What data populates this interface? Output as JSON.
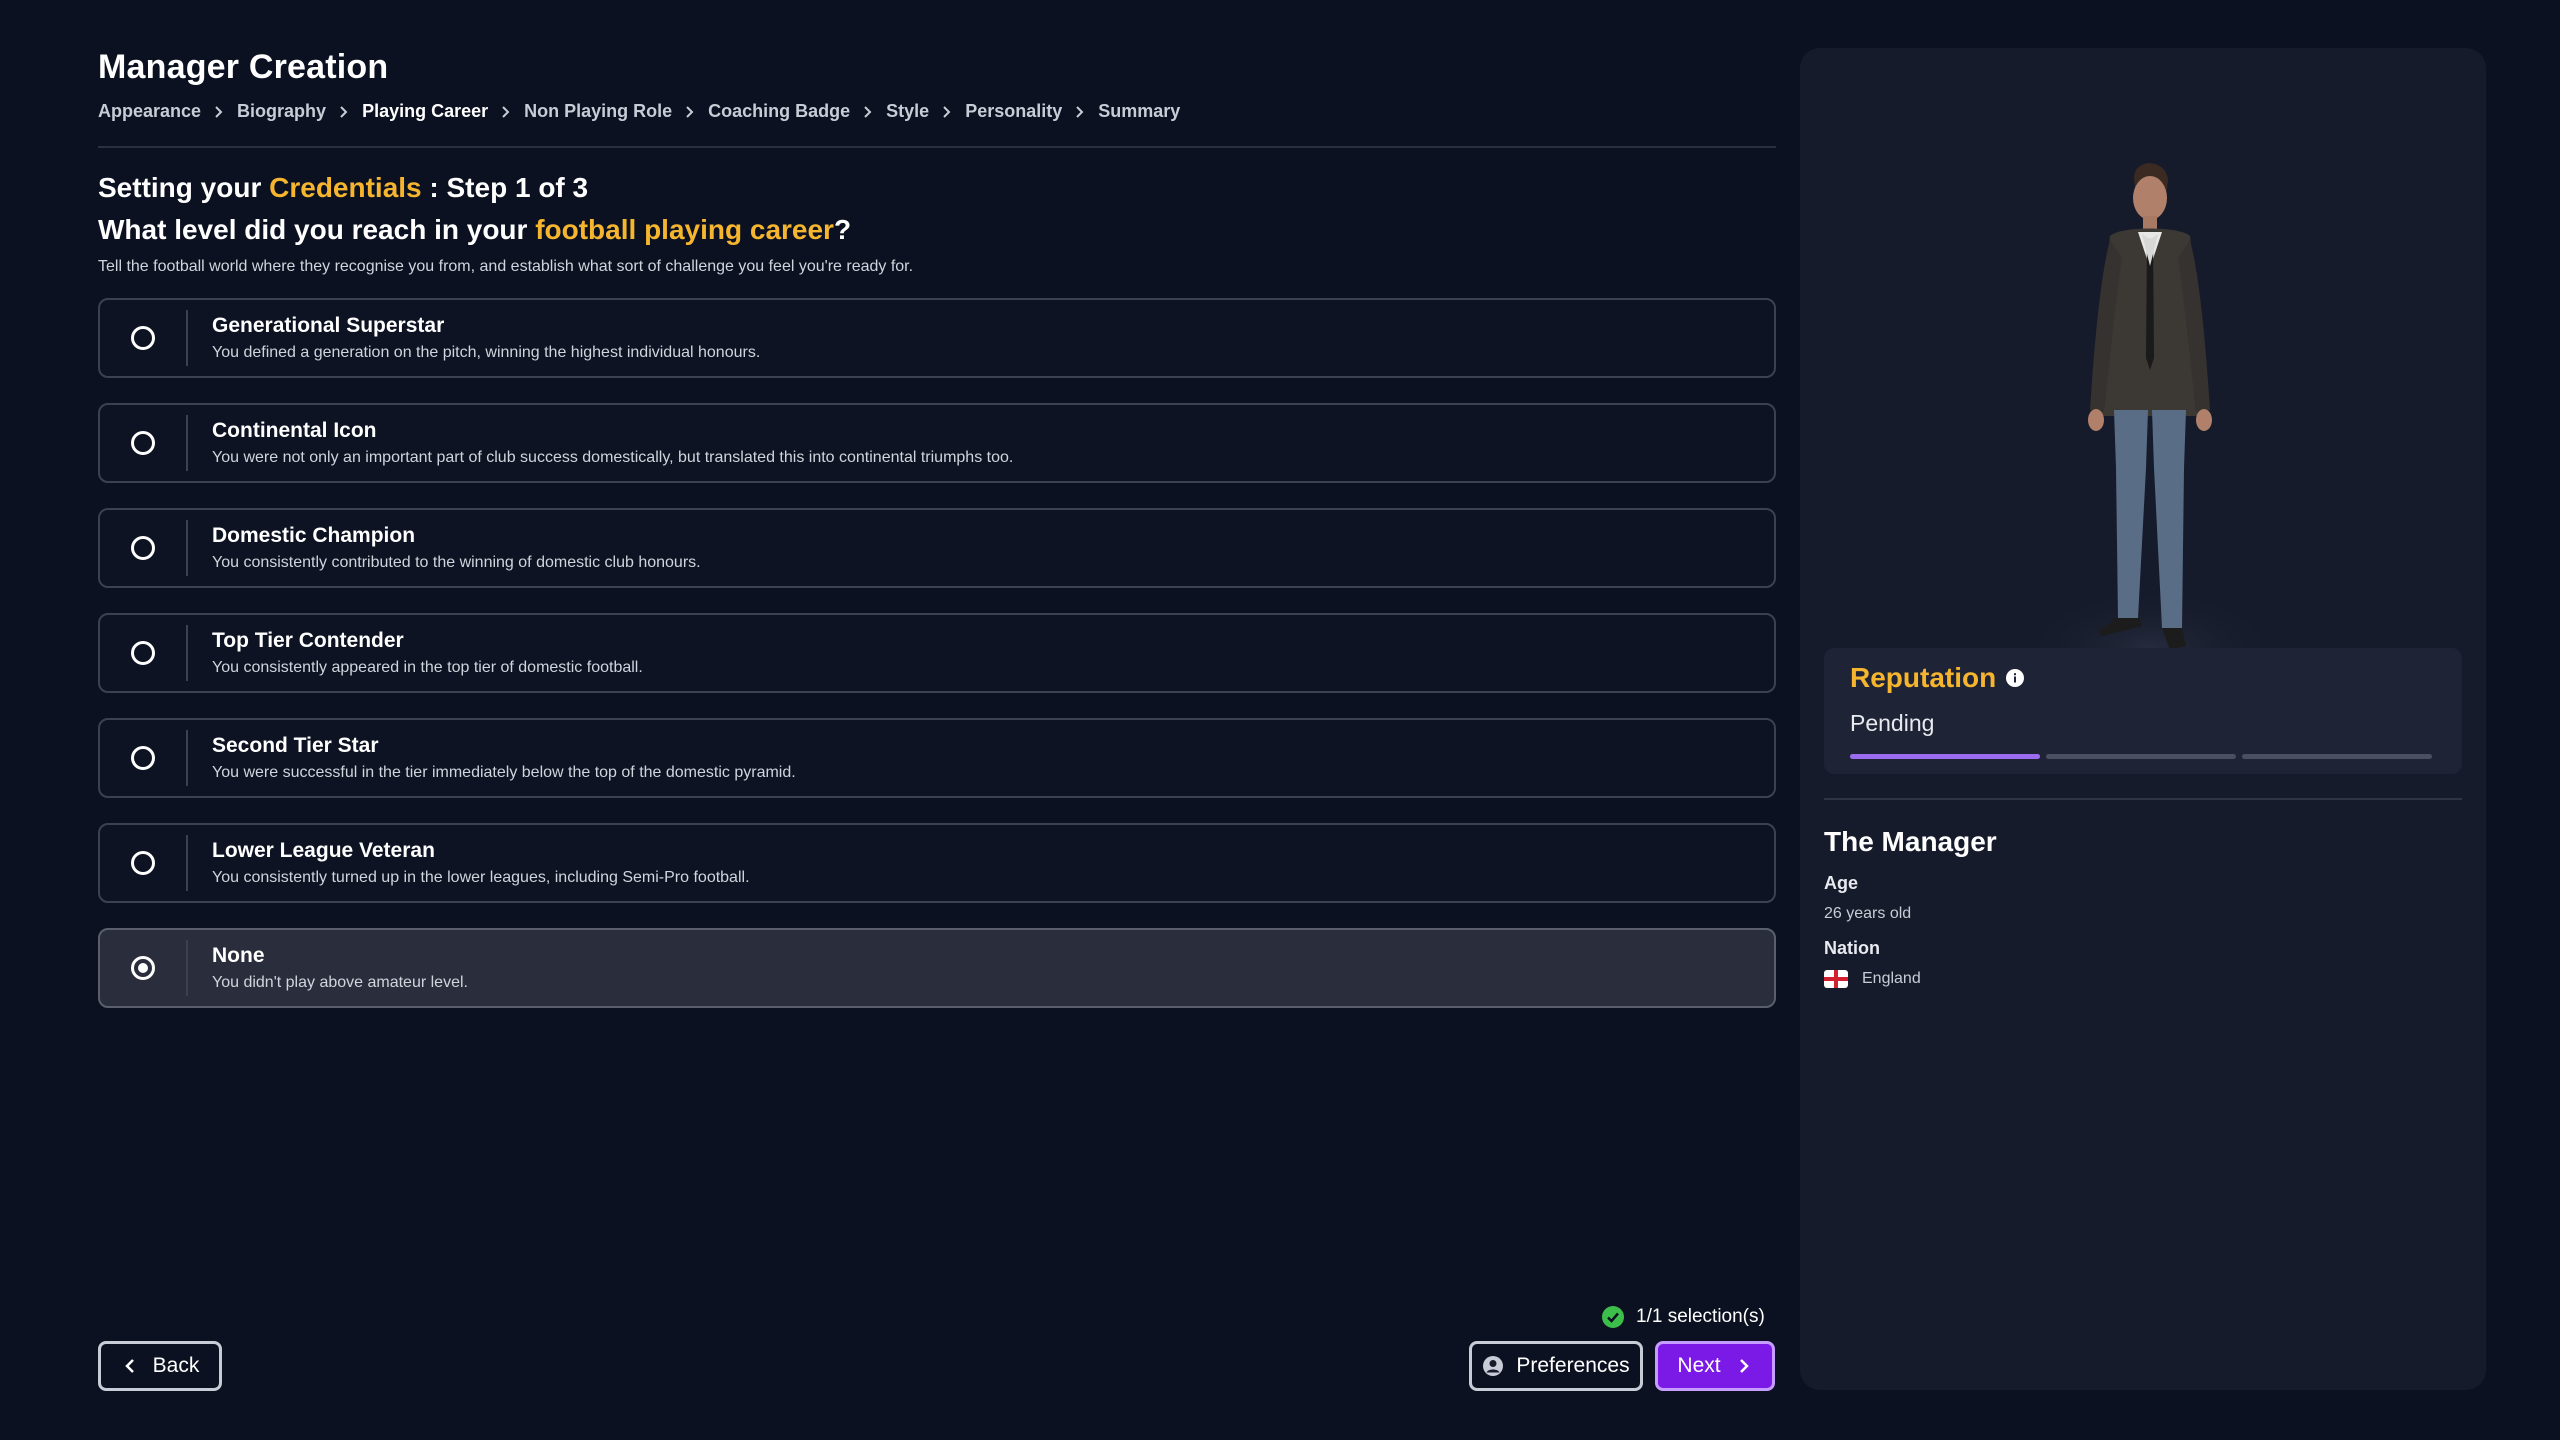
{
  "header": {
    "title": "Manager Creation",
    "breadcrumb": [
      "Appearance",
      "Biography",
      "Playing Career",
      "Non Playing Role",
      "Coaching Badge",
      "Style",
      "Personality",
      "Summary"
    ],
    "active_step": "Playing Career"
  },
  "question": {
    "line1_prefix": "Setting your ",
    "line1_accent": "Credentials",
    "line1_suffix": " : Step 1 of 3",
    "line2_prefix": "What level did you reach in your ",
    "line2_accent": "football playing career",
    "line2_suffix": "?",
    "description": "Tell the football world where they recognise you from, and establish what sort of challenge you feel you're ready for."
  },
  "options": [
    {
      "title": "Generational Superstar",
      "desc": "You defined a generation on the pitch, winning the highest individual honours.",
      "selected": false
    },
    {
      "title": "Continental Icon",
      "desc": "You were not only an important part of club success domestically, but translated this into continental triumphs too.",
      "selected": false
    },
    {
      "title": "Domestic Champion",
      "desc": "You consistently contributed to the winning of domestic club honours.",
      "selected": false
    },
    {
      "title": "Top Tier Contender",
      "desc": "You consistently appeared in the top tier of domestic football.",
      "selected": false
    },
    {
      "title": "Second Tier Star",
      "desc": "You were successful in the tier immediately below the top of the domestic pyramid.",
      "selected": false
    },
    {
      "title": "Lower League Veteran",
      "desc": "You consistently turned up in the lower leagues, including Semi-Pro football.",
      "selected": false
    },
    {
      "title": "None",
      "desc": "You didn't play above amateur level.",
      "selected": true
    }
  ],
  "selection_status": "1/1 selection(s)",
  "buttons": {
    "back": "Back",
    "preferences": "Preferences",
    "next": "Next"
  },
  "side": {
    "reputation_title": "Reputation",
    "reputation_status": "Pending",
    "reputation_progress": 0.333,
    "manager_title": "The Manager",
    "age_label": "Age",
    "age_value": "26 years old",
    "nation_label": "Nation",
    "nation_value": "England"
  },
  "colors": {
    "accent": "#f5b52e",
    "next_button": "#7b19e6",
    "reputation_fill": "#9b6cf0",
    "check": "#3dbd4a"
  },
  "icons": [
    "chevron-right-icon",
    "chevron-left-icon",
    "radio-icon",
    "check-circle-icon",
    "user-icon",
    "info-icon",
    "england-flag-icon"
  ]
}
